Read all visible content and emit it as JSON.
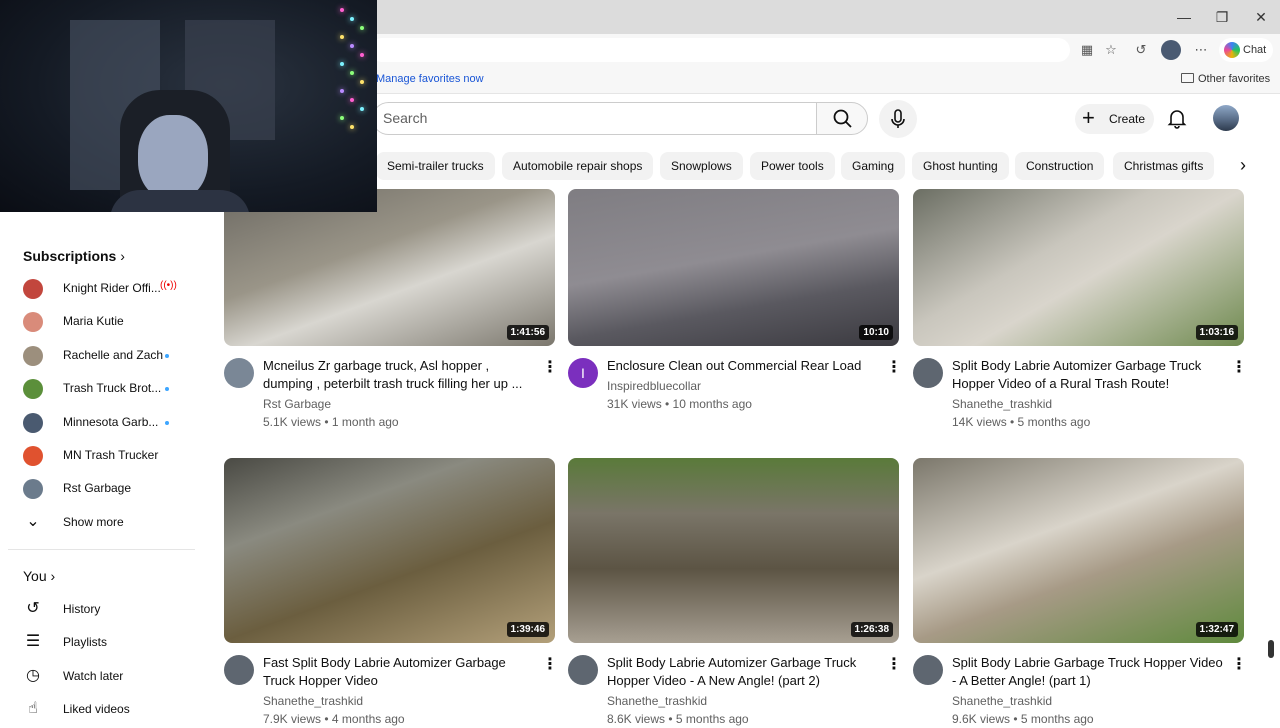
{
  "browser": {
    "favorites_link": "Manage favorites now",
    "other_favorites": "Other favorites",
    "chat_label": "Chat",
    "window_controls": [
      "minimize-icon",
      "restore-icon",
      "close-icon"
    ]
  },
  "header": {
    "search_placeholder": "Search",
    "create_label": "Create"
  },
  "chips": [
    "Semi-trailer trucks",
    "Automobile repair shops",
    "Snowplows",
    "Power tools",
    "Gaming",
    "Ghost hunting",
    "Construction",
    "Christmas gifts"
  ],
  "sidebar": {
    "subscriptions_title": "Subscriptions",
    "subscriptions": [
      {
        "name": "Knight Rider Offi...",
        "status": "live",
        "color": "#c2463d"
      },
      {
        "name": "Maria Kutie",
        "status": "",
        "color": "#d98b7a"
      },
      {
        "name": "Rachelle and Zach",
        "status": "new",
        "color": "#9c8f7d"
      },
      {
        "name": "Trash Truck Brot...",
        "status": "new",
        "color": "#5b8f3a"
      },
      {
        "name": "Minnesota Garb...",
        "status": "new",
        "color": "#4a5a70"
      },
      {
        "name": "MN Trash Trucker",
        "status": "",
        "color": "#e0522f"
      },
      {
        "name": "Rst Garbage",
        "status": "",
        "color": "#6b7b8c"
      }
    ],
    "show_more": "Show more",
    "you_title": "You",
    "you_items": [
      {
        "label": "History",
        "icon": "history-icon"
      },
      {
        "label": "Playlists",
        "icon": "playlists-icon"
      },
      {
        "label": "Watch later",
        "icon": "watch-later-icon"
      },
      {
        "label": "Liked videos",
        "icon": "liked-videos-icon"
      }
    ]
  },
  "videos": [
    {
      "title": "Mcneilus Zr garbage truck, Asl hopper , dumping , peterbilt trash truck filling her up ...",
      "channel": "Rst Garbage",
      "meta": "5.1K views • 1 month ago",
      "duration": "1:41:56",
      "avatar": "#7a8796"
    },
    {
      "title": "Enclosure Clean out Commercial Rear Load",
      "channel": "Inspiredbluecollar",
      "meta": "31K views • 10 months ago",
      "duration": "10:10",
      "avatar": "#7b2fbe",
      "avatar_letter": "I"
    },
    {
      "title": "Split Body Labrie Automizer Garbage Truck Hopper Video of a Rural Trash Route!",
      "channel": "Shanethe_trashkid",
      "meta": "14K views • 5 months ago",
      "duration": "1:03:16",
      "avatar": "#5e6670"
    },
    {
      "title": "Fast Split Body Labrie Automizer Garbage Truck Hopper Video",
      "channel": "Shanethe_trashkid",
      "meta": "7.9K views • 4 months ago",
      "duration": "1:39:46",
      "avatar": "#5e6670"
    },
    {
      "title": "Split Body Labrie Automizer Garbage Truck Hopper Video - A New Angle! (part 2)",
      "channel": "Shanethe_trashkid",
      "meta": "8.6K views • 5 months ago",
      "duration": "1:26:38",
      "avatar": "#5e6670"
    },
    {
      "title": "Split Body Labrie Garbage Truck Hopper Video - A Better Angle! (part 1)",
      "channel": "Shanethe_trashkid",
      "meta": "9.6K views • 5 months ago",
      "duration": "1:32:47",
      "avatar": "#5e6670"
    }
  ]
}
